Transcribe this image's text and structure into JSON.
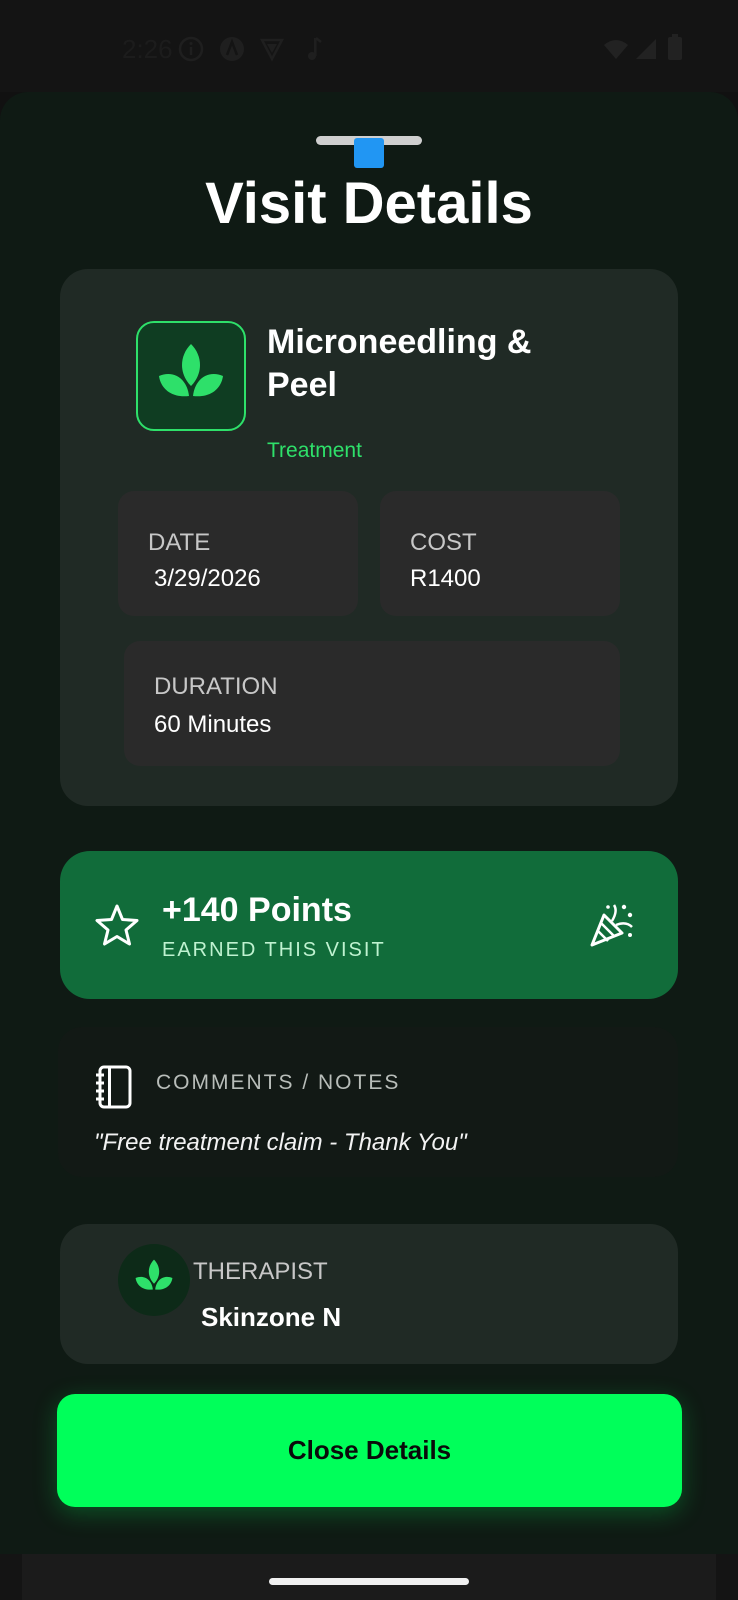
{
  "status_bar": {
    "time": "2:26",
    "icons": [
      "info-icon",
      "app-a-icon",
      "shield-icon",
      "music-note-icon"
    ],
    "right_icons": [
      "wifi-icon",
      "signal-icon",
      "battery-icon"
    ]
  },
  "sheet": {
    "title": "Visit Details"
  },
  "visit": {
    "name": "Microneedling & Peel",
    "type": "Treatment",
    "date_label": "DATE",
    "date_value": "3/29/2026",
    "cost_label": "COST",
    "cost_value": "R1400",
    "duration_label": "DURATION",
    "duration_value": "60 Minutes"
  },
  "points": {
    "title": "+140 Points",
    "subtitle": "EARNED THIS VISIT"
  },
  "notes": {
    "label": "COMMENTS / NOTES",
    "text": "\"Free treatment claim - Thank You\""
  },
  "therapist": {
    "label": "THERAPIST",
    "name": "Skinzone N"
  },
  "actions": {
    "close_label": "Close Details"
  },
  "colors": {
    "accent": "#00ff5a",
    "brand_green": "#2ee06a",
    "points_bg": "#116c3a",
    "drag_indicator": "#2196f3"
  }
}
